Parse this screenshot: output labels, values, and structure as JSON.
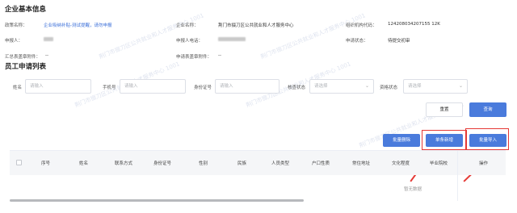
{
  "section1": {
    "title": "企业基本信息"
  },
  "info": {
    "policy_label": "政策名称：",
    "policy_value": "企业吸纳补贴-测试提醒，请勿申报",
    "company_label": "企业名称：",
    "company_value": "荆门市掇刀区公共就业和人才服务中心",
    "org_code_label": "组织机构代码：",
    "org_code_value": "124208034207155 12K",
    "applicant_label": "申报人：",
    "phone_label": "申报人电话：",
    "status_label": "申请状态：",
    "status_value": "待提交初审",
    "summary_attach_label": "汇总表盖章附件：",
    "summary_attach_value": "--",
    "apply_attach_label": "申请表盖章附件：",
    "apply_attach_value": "--"
  },
  "section2": {
    "title": "员工申请列表"
  },
  "filters": {
    "name_label": "姓名",
    "name_placeholder": "请输入",
    "phone_label": "手机号",
    "phone_placeholder": "请输入",
    "idcard_label": "身份证号",
    "idcard_placeholder": "请输入",
    "audit_label": "核查状态",
    "audit_placeholder": "请选择",
    "enjoy_label": "资格状态",
    "enjoy_placeholder": "请选择"
  },
  "buttons": {
    "reset": "重置",
    "search": "查询",
    "batch_delete": "批量删除",
    "single_add": "单条新增",
    "batch_import": "批量导入"
  },
  "table": {
    "columns": [
      "序号",
      "姓名",
      "联系方式",
      "身份证号",
      "性别",
      "民族",
      "人员类型",
      "户口性质",
      "常住地址",
      "文化程度",
      "毕业院校",
      "操作"
    ],
    "empty_text": "暂无数据"
  },
  "watermark": "荆门市掇刀区公共就业和人才服务中心 1001",
  "colors": {
    "primary": "#4a7bdc",
    "link": "#3b6fd9",
    "annotation_red": "#e53935"
  }
}
